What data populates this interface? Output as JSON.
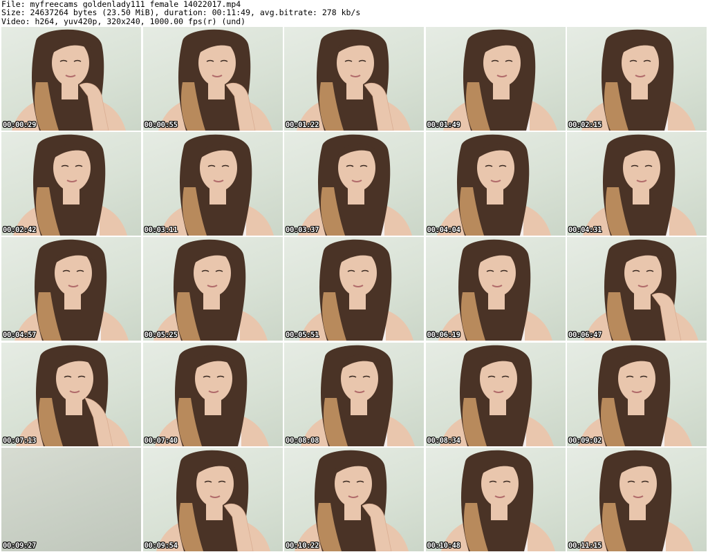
{
  "header": {
    "file_line": "File: myfreecams_goldenlady111_female_14022017.mp4",
    "size_line": "Size: 24637264 bytes (23.50 MiB), duration: 00:11:49, avg.bitrate: 278 kb/s",
    "video_line": "Video: h264, yuv420p, 320x240, 1000.00 fps(r) (und)"
  },
  "thumbnails": [
    {
      "time": "00:00:29",
      "variant": "chin-hand"
    },
    {
      "time": "00:00:55",
      "variant": "chin-hand"
    },
    {
      "time": "00:01:22",
      "variant": "chin-hand"
    },
    {
      "time": "00:01:49",
      "variant": "portrait"
    },
    {
      "time": "00:02:15",
      "variant": "portrait"
    },
    {
      "time": "00:02:42",
      "variant": "portrait"
    },
    {
      "time": "00:03:11",
      "variant": "portrait"
    },
    {
      "time": "00:03:37",
      "variant": "portrait"
    },
    {
      "time": "00:04:04",
      "variant": "portrait"
    },
    {
      "time": "00:04:31",
      "variant": "portrait"
    },
    {
      "time": "00:04:57",
      "variant": "portrait"
    },
    {
      "time": "00:05:25",
      "variant": "portrait"
    },
    {
      "time": "00:05:51",
      "variant": "portrait"
    },
    {
      "time": "00:06:19",
      "variant": "portrait"
    },
    {
      "time": "00:06:47",
      "variant": "chin-hand"
    },
    {
      "time": "00:07:13",
      "variant": "neck-hand"
    },
    {
      "time": "00:07:40",
      "variant": "portrait"
    },
    {
      "time": "00:08:08",
      "variant": "portrait"
    },
    {
      "time": "00:08:34",
      "variant": "portrait"
    },
    {
      "time": "00:09:02",
      "variant": "portrait"
    },
    {
      "time": "00:09:27",
      "variant": "blank"
    },
    {
      "time": "00:09:54",
      "variant": "chin-hand"
    },
    {
      "time": "00:10:22",
      "variant": "chin-hand"
    },
    {
      "time": "00:10:48",
      "variant": "portrait"
    },
    {
      "time": "00:11:15",
      "variant": "portrait"
    }
  ],
  "colors": {
    "background": "#ffffff",
    "hair": "#4a3326",
    "hair_light": "#b88a5c",
    "skin": "#e9c6ad",
    "strap": "#f4eeec",
    "timestamp_text": "#ffffff",
    "timestamp_outline": "#000000"
  }
}
